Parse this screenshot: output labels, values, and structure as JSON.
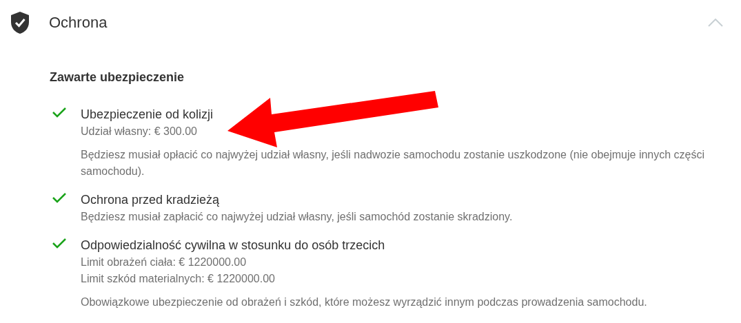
{
  "panel": {
    "title": "Ochrona",
    "expanded": true
  },
  "section": {
    "heading": "Zawarte ubezpieczenie",
    "items": [
      {
        "included": true,
        "title": "Ubezpieczenie od kolizji",
        "details": [
          "Udział własny: € 300.00"
        ],
        "description": "Będziesz musiał opłacić co najwyżej udział własny, jeśli nadwozie samochodu zostanie uszkodzone (nie obejmuje innych części samochodu)."
      },
      {
        "included": true,
        "title": "Ochrona przed kradzieżą",
        "description": "Będziesz musiał zapłacić co najwyżej udział własny, jeśli samochód zostanie skradziony."
      },
      {
        "included": true,
        "title": "Odpowiedzialność cywilna w stosunku do osób trzecich",
        "details": [
          "Limit obrażeń ciała: € 1220000.00",
          "Limit szkód materialnych: € 1220000.00"
        ],
        "description": "Obowiązkowe ubezpieczenie od obrażeń i szkód, które możesz wyrządzić innym podczas prowadzenia samochodu."
      }
    ]
  }
}
